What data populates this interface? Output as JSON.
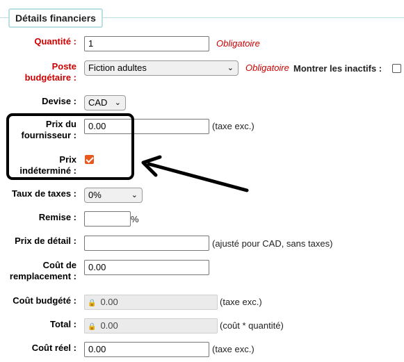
{
  "section": {
    "title": "Détails financiers"
  },
  "fields": {
    "quantity": {
      "label": "Quantité :",
      "value": "1",
      "required_note": "Obligatoire"
    },
    "budget": {
      "label": "Poste budgétaire :",
      "value": "Fiction adultes",
      "required_note": "Obligatoire",
      "show_inactive_label": "Montrer les inactifs :",
      "show_inactive_checked": false
    },
    "currency": {
      "label": "Devise :",
      "value": "CAD"
    },
    "vendor_price": {
      "label": "Prix du fournisseur :",
      "value": "0.00",
      "note": "(taxe exc.)"
    },
    "undetermined_price": {
      "label": "Prix indéterminé :",
      "checked": true
    },
    "tax_rate": {
      "label": "Taux de taxes :",
      "value": "0%"
    },
    "discount": {
      "label": "Remise :",
      "value": "",
      "suffix": "%"
    },
    "retail_price": {
      "label": "Prix de détail :",
      "value": "",
      "note": "(ajusté pour CAD, sans taxes)"
    },
    "replacement_cost": {
      "label": "Coût de remplacement :",
      "value": "0.00"
    },
    "budgeted_cost": {
      "label": "Coût budgété :",
      "value": "0.00",
      "note": "(taxe exc.)"
    },
    "total": {
      "label": "Total :",
      "value": "0.00",
      "note": "(coût * quantité)"
    },
    "actual_cost": {
      "label": "Coût réel :",
      "value": "0.00",
      "note": "(taxe exc.)"
    }
  },
  "colors": {
    "required": "#cc0000",
    "accent_checkbox": "#e8581f",
    "fieldset_border": "#b8dfe2"
  },
  "icons": {
    "select_arrow": "chevron-down-icon",
    "readonly": "lock-icon"
  }
}
